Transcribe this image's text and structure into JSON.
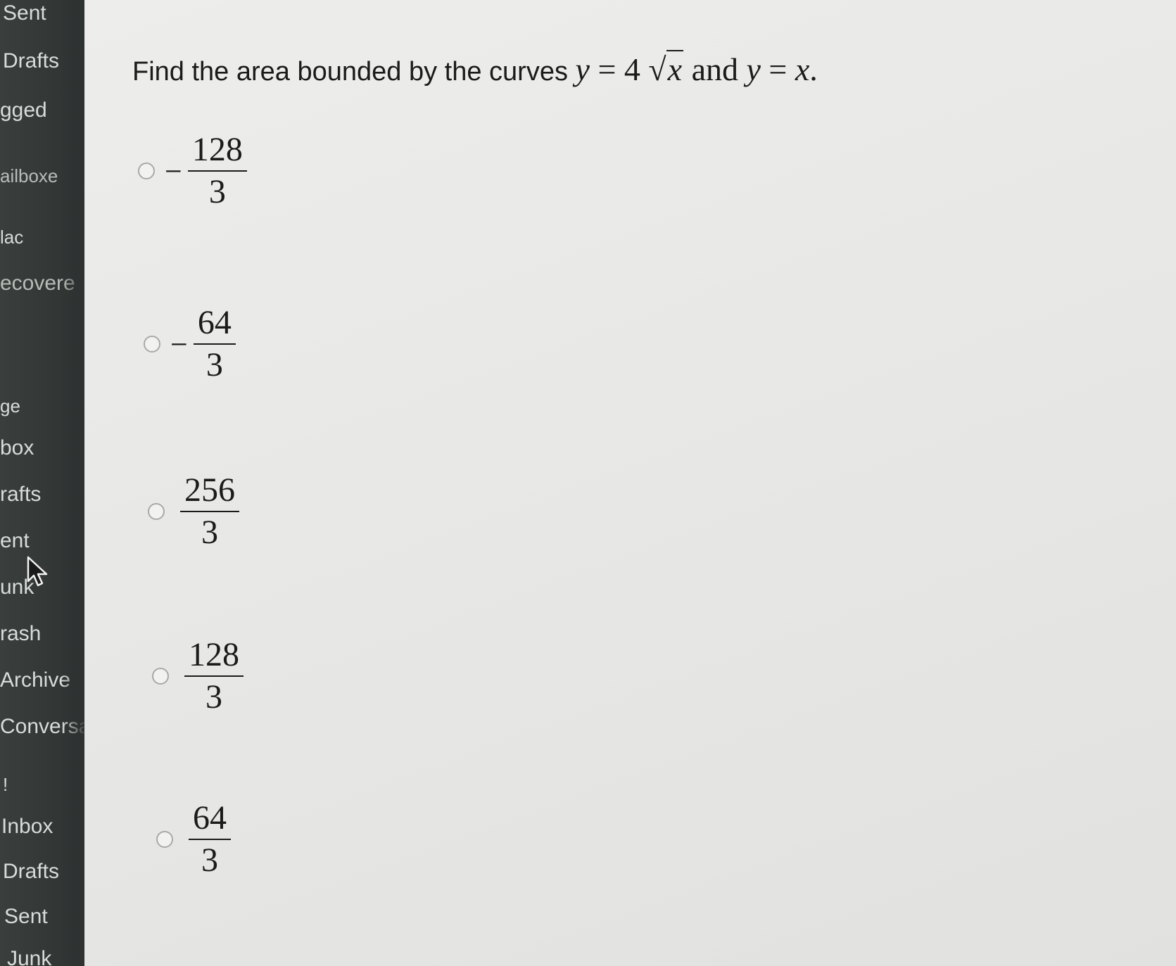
{
  "sidebar": {
    "items": [
      {
        "label": "Sent"
      },
      {
        "label": "Drafts"
      },
      {
        "label": "gged"
      },
      {
        "label": "ailboxe"
      },
      {
        "label": "lac"
      },
      {
        "label": "ecovere"
      },
      {
        "label": "ge"
      },
      {
        "label": "box"
      },
      {
        "label": "rafts"
      },
      {
        "label": "ent"
      },
      {
        "label": "unk"
      },
      {
        "label": "rash"
      },
      {
        "label": "Archive"
      },
      {
        "label": "Conversa"
      },
      {
        "label": "!"
      },
      {
        "label": "Inbox"
      },
      {
        "label": "Drafts"
      },
      {
        "label": "Sent"
      },
      {
        "label": "Junk"
      }
    ]
  },
  "question": {
    "text": "Find the area bounded by the curves",
    "curve1_lhs": "y",
    "curve1_eq": " = 4 ",
    "curve1_rad": "x",
    "connector": " and ",
    "curve2_lhs": "y",
    "curve2_eq": " = ",
    "curve2_rhs": "x",
    "end": "."
  },
  "options": [
    {
      "sign": "−",
      "numerator": "128",
      "denominator": "3"
    },
    {
      "sign": "−",
      "numerator": "64",
      "denominator": "3"
    },
    {
      "sign": "",
      "numerator": "256",
      "denominator": "3"
    },
    {
      "sign": "",
      "numerator": "128",
      "denominator": "3"
    },
    {
      "sign": "",
      "numerator": "64",
      "denominator": "3"
    }
  ]
}
